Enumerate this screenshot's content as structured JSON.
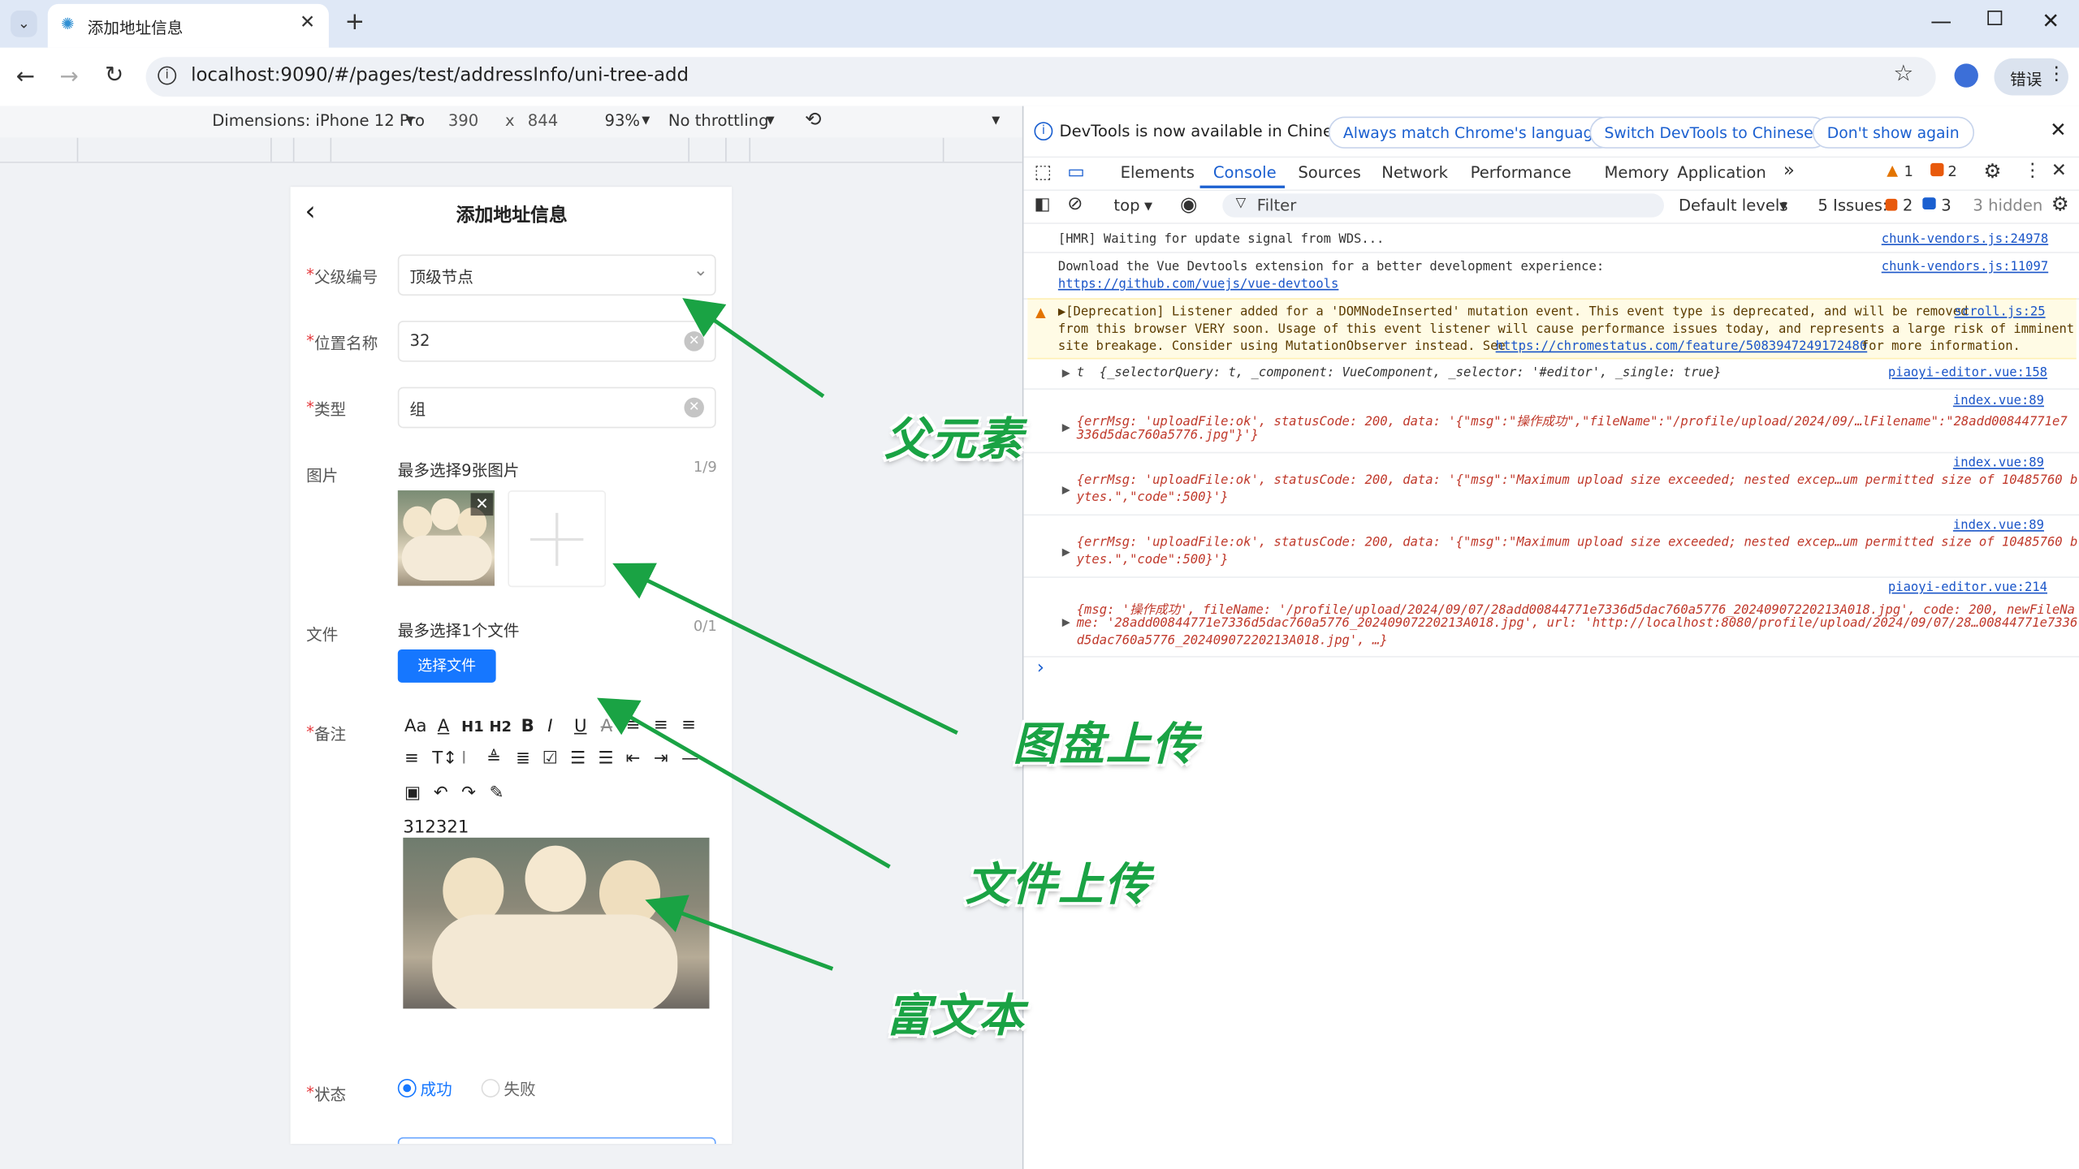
{
  "browser": {
    "tab_title": "添加地址信息",
    "url": "localhost:9090/#/pages/test/addressInfo/uni-tree-add",
    "profile_label": "错误"
  },
  "device_toolbar": {
    "dimensions": "Dimensions: iPhone 12 Pro",
    "width": "390",
    "x": "x",
    "height": "844",
    "zoom": "93%",
    "throttling": "No throttling"
  },
  "form": {
    "title": "添加地址信息",
    "parent_label": "父级编号",
    "parent_value": "顶级节点",
    "name_label": "位置名称",
    "name_value": "32",
    "type_label": "类型",
    "type_value": "组",
    "image_label": "图片",
    "image_hint": "最多选择9张图片",
    "image_count": "1/9",
    "file_label": "文件",
    "file_hint": "最多选择1个文件",
    "file_count": "0/1",
    "file_button": "选择文件",
    "remark_label": "备注",
    "editor_text": "312321",
    "status_label": "状态",
    "status_success": "成功",
    "status_fail": "失败",
    "required_mark": "*"
  },
  "annotations": {
    "parent": "父元素",
    "image_upload": "图盘上传",
    "file_upload": "文件上传",
    "rich_text": "富文本"
  },
  "devtools": {
    "banner": "DevTools is now available in Chinese!",
    "banner_btn1": "Always match Chrome's language",
    "banner_btn2": "Switch DevTools to Chinese",
    "banner_btn3": "Don't show again",
    "tabs": [
      "Elements",
      "Console",
      "Sources",
      "Network",
      "Performance",
      "Memory",
      "Application"
    ],
    "warn_count": "1",
    "err_count": "2",
    "context": "top",
    "filter_placeholder": "Filter",
    "levels": "Default levels",
    "issues_label": "5 Issues:",
    "issues_err": "2",
    "issues_info": "3",
    "hidden": "3 hidden",
    "logs": [
      {
        "text": "[HMR] Waiting for update signal from WDS...",
        "src": "chunk-vendors.js:24978"
      },
      {
        "text": "Download the Vue Devtools extension for a better development experience:",
        "link": "https://github.com/vuejs/vue-devtools",
        "src": "chunk-vendors.js:11097"
      },
      {
        "line1": "▶[Deprecation] Listener added for a 'DOMNodeInserted' mutation event. This event type is deprecated, and will be removed",
        "line2": "from this browser VERY soon. Usage of this event listener will cause performance issues today, and represents a large risk of imminent",
        "line3": "site breakage. Consider using MutationObserver instead. See ",
        "link": "https://chromestatus.com/feature/5083947249172480",
        "line3b": " for more information.",
        "src": "scroll.js:25"
      },
      {
        "text": "t  {_selectorQuery: t, _component: VueComponent, _selector: '#editor', _single: true}",
        "src": "piaoyi-editor.vue:158"
      },
      {
        "src": "index.vue:89",
        "line1": "{errMsg: 'uploadFile:ok', statusCode: 200, data: '{\"msg\":\"操作成功\",\"fileName\":\"/profile/upload/2024/09/…lFilename\":\"28add00844771e7",
        "line2": "336d5dac760a5776.jpg\"}'}"
      },
      {
        "src": "index.vue:89",
        "line1": "{errMsg: 'uploadFile:ok', statusCode: 200, data: '{\"msg\":\"Maximum upload size exceeded; nested excep…um permitted size of 10485760 b",
        "line2": "ytes.\",\"code\":500}'}"
      },
      {
        "src": "index.vue:89",
        "line1": "{errMsg: 'uploadFile:ok', statusCode: 200, data: '{\"msg\":\"Maximum upload size exceeded; nested excep…um permitted size of 10485760 b",
        "line2": "ytes.\",\"code\":500}'}"
      },
      {
        "src": "piaoyi-editor.vue:214",
        "line1": "{msg: '操作成功', fileName: '/profile/upload/2024/09/07/28add00844771e7336d5dac760a5776_20240907220213A018.jpg', code: 200, newFileNa",
        "line2": "me: '28add00844771e7336d5dac760a5776_20240907220213A018.jpg', url: 'http://localhost:8080/profile/upload/2024/09/07/28…00844771e7336",
        "line3": "d5dac760a5776_20240907220213A018.jpg', …}"
      }
    ]
  },
  "colors": {
    "accent": "#1677ff",
    "annotation_green": "#1aa344",
    "warn_bg": "#fffbe5"
  }
}
